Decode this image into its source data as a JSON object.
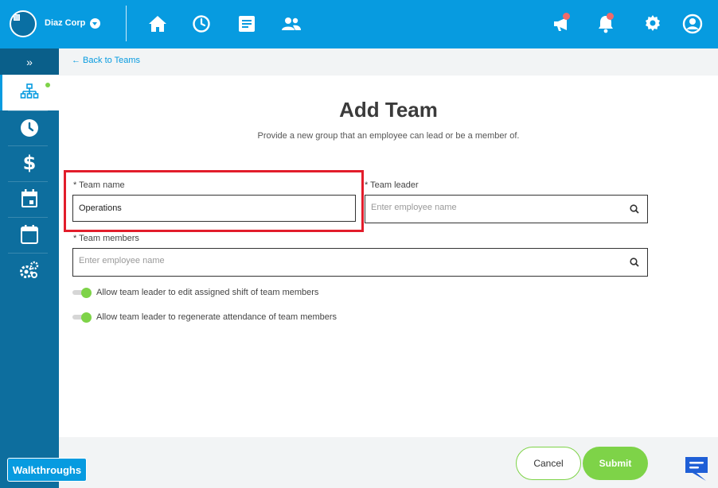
{
  "header": {
    "company": "Diaz Corp",
    "icons": [
      "home-icon",
      "clock-icon",
      "document-icon",
      "people-icon",
      "megaphone-icon",
      "bell-icon",
      "gear-icon",
      "user-icon"
    ]
  },
  "sidebar": {
    "collapse": "»",
    "items": [
      "org-chart-icon",
      "clock-icon",
      "dollar-icon",
      "calendar-event-icon",
      "calendar-icon",
      "settings-gears-icon"
    ]
  },
  "breadcrumb": {
    "back_label": "← Back to Teams"
  },
  "form": {
    "title": "Add Team",
    "subtitle": "Provide a new group that an employee can lead or be a member of.",
    "team_name_label": "* Team name",
    "team_name_value": "Operations",
    "team_leader_label": "* Team leader",
    "team_leader_placeholder": "Enter employee name",
    "team_members_label": "* Team members",
    "team_members_placeholder": "Enter employee name",
    "toggle1_label": "Allow team leader to edit assigned shift of team members",
    "toggle1_on": true,
    "toggle2_label": "Allow team leader to regenerate attendance of team members",
    "toggle2_on": true
  },
  "footer": {
    "cancel_label": "Cancel",
    "submit_label": "Submit",
    "walkthroughs_label": "Walkthroughs"
  },
  "colors": {
    "brand": "#079be0",
    "sidebar": "#0d6e9e",
    "accent_green": "#7ed348",
    "highlight": "#e21d2b"
  }
}
